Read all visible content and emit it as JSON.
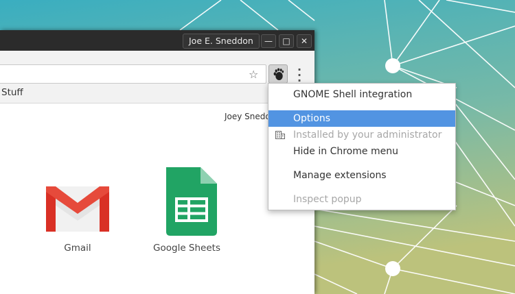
{
  "window": {
    "profile_name": "Joe E. Sneddon",
    "controls": {
      "minimize": "—",
      "maximize": "□",
      "close": "✕"
    }
  },
  "toolbar": {
    "star_icon": "star-icon",
    "extension_icon": "gnome-foot-icon",
    "menu_icon": "kebab-menu-icon"
  },
  "bookmarks_bar": {
    "label": "Stuff"
  },
  "new_tab_page": {
    "user_name": "Joey Snedd",
    "apps": [
      {
        "label": "Gmail"
      },
      {
        "label": "Google Sheets"
      }
    ]
  },
  "extension_menu": {
    "items": [
      {
        "label": "GNOME Shell integration",
        "state": "normal"
      },
      {
        "label": "Options",
        "state": "selected"
      },
      {
        "label": "Installed by your administrator",
        "state": "disabled"
      },
      {
        "label": "Hide in Chrome menu",
        "state": "normal"
      },
      {
        "label": "Manage extensions",
        "state": "normal"
      },
      {
        "label": "Inspect popup",
        "state": "disabled"
      }
    ]
  },
  "colors": {
    "menu_highlight": "#5294e2",
    "titlebar": "#2b2b2b",
    "gmail_red": "#d93025",
    "sheets_green": "#21a464"
  }
}
